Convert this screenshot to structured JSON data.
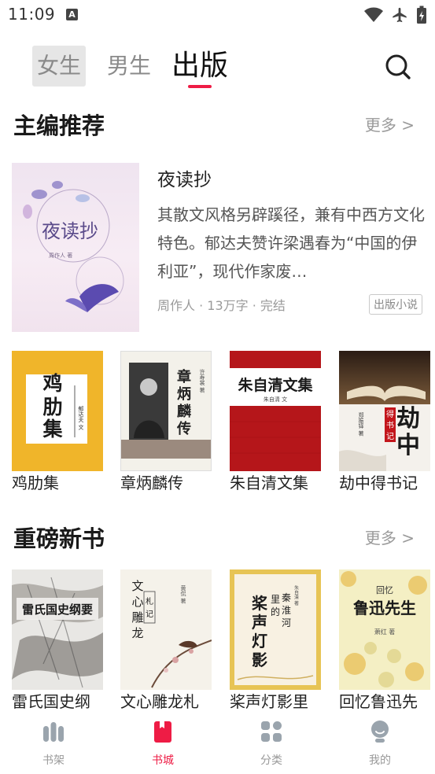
{
  "status_bar": {
    "time": "11:09",
    "indicator": "A",
    "icons": [
      "wifi-icon",
      "airplane-icon",
      "battery-charging-icon"
    ]
  },
  "top_tabs": {
    "female": "女生",
    "male": "男生",
    "publish": "出版",
    "active": "publish",
    "accent_color": "#ee1c45"
  },
  "editor_pick": {
    "title": "主编推荐",
    "more": "更多 >",
    "featured": {
      "title": "夜读抄",
      "description": "其散文风格另辟蹊径，兼有中西方文化特色。郁达夫赞许梁遇春为“中国的伊利亚”，现代作家废…",
      "meta": "周作人 · 13万字 · 完结",
      "tag": "出版小说",
      "cover_text": "夜读抄",
      "cover_author": "周作人 著"
    },
    "books": [
      {
        "name": "鸡肋集",
        "cover_title": "鸡肋集",
        "cover_author": "郁达夫 文"
      },
      {
        "name": "章炳麟传",
        "cover_title": "章炳麟传",
        "cover_author": "许寿裳 著"
      },
      {
        "name": "朱自清文集",
        "cover_title": "朱自清文集",
        "cover_author": "朱自清 文"
      },
      {
        "name": "劫中得书记",
        "cover_title": "劫中",
        "cover_sub": "得书记",
        "cover_author": "郑振铎 著"
      }
    ]
  },
  "new_books": {
    "title": "重磅新书",
    "more": "更多 >",
    "books": [
      {
        "name": "雷氏国史纲",
        "cover_title": "雷氏国史纲要"
      },
      {
        "name": "文心雕龙札",
        "cover_title": "文心雕龙",
        "cover_sub": "札记",
        "cover_author": "黄侃 著"
      },
      {
        "name": "桨声灯影里",
        "cover_title": "桨声灯影",
        "cover_sub": "里的秦淮河",
        "cover_author": "朱自清 著"
      },
      {
        "name": "回忆鲁迅先",
        "cover_title": "鲁迅先生",
        "cover_sub": "回忆",
        "cover_author": "萧红 著"
      }
    ]
  },
  "bottom_nav": {
    "items": [
      {
        "label": "书架",
        "icon": "bookshelf-icon"
      },
      {
        "label": "书城",
        "icon": "bookstore-icon",
        "active": true
      },
      {
        "label": "分类",
        "icon": "category-icon"
      },
      {
        "label": "我的",
        "icon": "profile-icon"
      }
    ]
  }
}
